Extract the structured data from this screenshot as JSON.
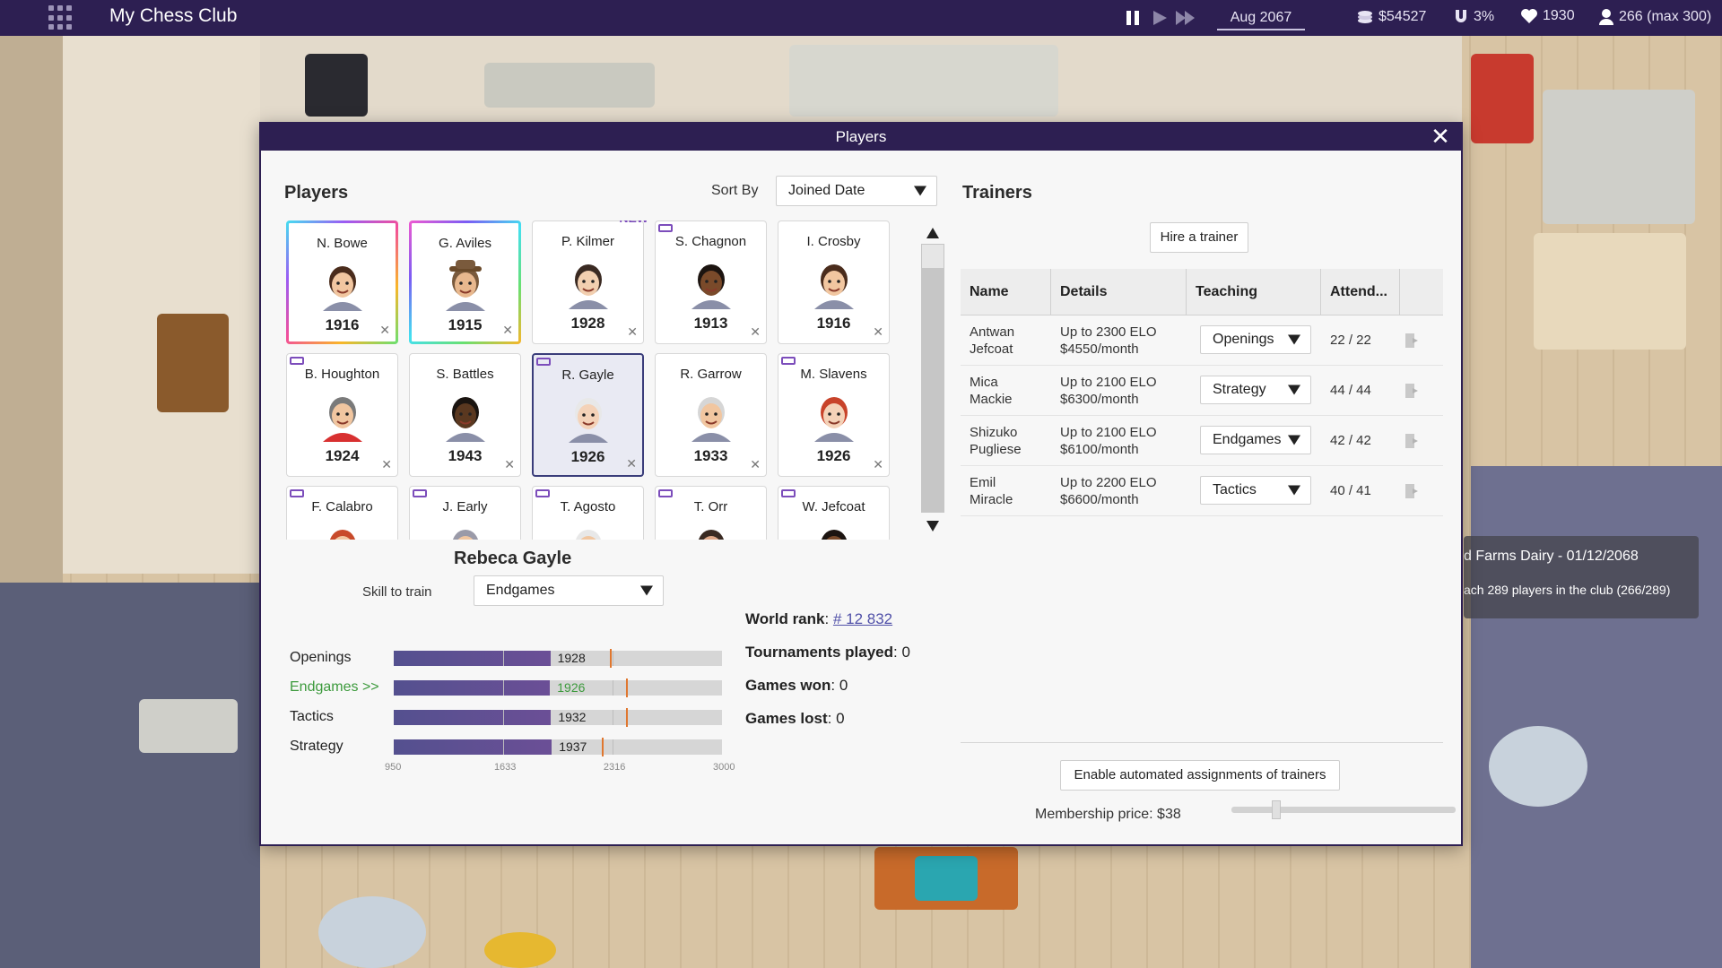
{
  "topbar": {
    "club_name": "My Chess Club",
    "date": "Aug 2067",
    "money": "$54527",
    "percentage": "3%",
    "hearts": "1930",
    "members": "266 (max 300)"
  },
  "dialog": {
    "title": "Players"
  },
  "players_panel": {
    "heading": "Players",
    "sort_label": "Sort By",
    "sort_value": "Joined Date",
    "cards": [
      {
        "name": "N. Bowe",
        "elo": "1916",
        "hair": "#4a2c1c",
        "skin": "#f1c6a0",
        "frame": "rainbow"
      },
      {
        "name": "G. Aviles",
        "elo": "1915",
        "hair": "#7a5a3c",
        "skin": "#e8b88e",
        "frame": "rainbow2",
        "hat": true
      },
      {
        "name": "P. Kilmer",
        "elo": "1928",
        "hair": "#3a2a22",
        "skin": "#f2cfb0",
        "new": "NEW"
      },
      {
        "name": "S. Chagnon",
        "elo": "1913",
        "hair": "#1c1410",
        "skin": "#7a4a2a",
        "tag": true
      },
      {
        "name": "I. Crosby",
        "elo": "1916",
        "hair": "#4a2c1c",
        "skin": "#f1c6a0"
      },
      {
        "name": "B. Houghton",
        "elo": "1924",
        "hair": "#7a7a7a",
        "skin": "#f1c6a0",
        "tag": true,
        "shirt": "#d83030"
      },
      {
        "name": "S. Battles",
        "elo": "1943",
        "hair": "#1a1410",
        "skin": "#5a3820"
      },
      {
        "name": "R. Gayle",
        "elo": "1926",
        "hair": "#e8e8e8",
        "skin": "#f4d2b8",
        "tag": true,
        "selected": true
      },
      {
        "name": "R. Garrow",
        "elo": "1933",
        "hair": "#d6d6d6",
        "skin": "#f1c6a0"
      },
      {
        "name": "M. Slavens",
        "elo": "1926",
        "hair": "#c8432a",
        "skin": "#f4d2b8",
        "tag": true
      },
      {
        "name": "F. Calabro",
        "elo": "",
        "hair": "#c84a2a",
        "skin": "#f1c6a0",
        "tag": true
      },
      {
        "name": "J. Early",
        "elo": "",
        "hair": "#9a9aa8",
        "skin": "#f1c6a0",
        "tag": true
      },
      {
        "name": "T. Agosto",
        "elo": "",
        "hair": "#e8e8e8",
        "skin": "#f1c6a0",
        "tag": true
      },
      {
        "name": "T. Orr",
        "elo": "",
        "hair": "#3a2a22",
        "skin": "#e0a888",
        "tag": true
      },
      {
        "name": "W. Jefcoat",
        "elo": "",
        "hair": "#1c1410",
        "skin": "#7a4a2a",
        "tag": true
      }
    ]
  },
  "selected_player": {
    "name": "Rebeca Gayle",
    "skill_label": "Skill to train",
    "skill_value": "Endgames",
    "skills": [
      {
        "name": "Openings",
        "value": 1928,
        "target": 2300
      },
      {
        "name": "Endgames >>",
        "value": 1926,
        "target": 2400,
        "active": true
      },
      {
        "name": "Tactics",
        "value": 1932,
        "target": 2400
      },
      {
        "name": "Strategy",
        "value": 1937,
        "target": 2250
      }
    ],
    "axis": {
      "min": 950,
      "max": 3000,
      "ticks": [
        "950",
        "1633",
        "2316",
        "3000"
      ]
    },
    "world_rank_label": "World rank",
    "world_rank": "# 12 832",
    "tournaments_label": "Tournaments played",
    "tournaments": "0",
    "games_won_label": "Games won",
    "games_won": "0",
    "games_lost_label": "Games lost",
    "games_lost": "0"
  },
  "trainers_panel": {
    "heading": "Trainers",
    "hire_button": "Hire a trainer",
    "columns": [
      "Name",
      "Details",
      "Teaching",
      "Attend..."
    ],
    "rows": [
      {
        "first": "Antwan",
        "last": "Jefcoat",
        "elo": "Up to 2300 ELO",
        "cost": "$4550/month",
        "teaching": "Openings",
        "attend": "22 / 22"
      },
      {
        "first": "Mica",
        "last": "Mackie",
        "elo": "Up to 2100 ELO",
        "cost": "$6300/month",
        "teaching": "Strategy",
        "attend": "44 / 44"
      },
      {
        "first": "Shizuko",
        "last": "Pugliese",
        "elo": "Up to 2100 ELO",
        "cost": "$6100/month",
        "teaching": "Endgames",
        "attend": "42 / 42"
      },
      {
        "first": "Emil",
        "last": "Miracle",
        "elo": "Up to 2200 ELO",
        "cost": "$6600/month",
        "teaching": "Tactics",
        "attend": "40 / 41"
      }
    ],
    "auto_button": "Enable automated assignments of trainers",
    "membership_label": "Membership price: $38",
    "membership_level": 0.2
  },
  "notification": {
    "title": "d Farms Dairy  -  01/12/2068",
    "body": "ach 289 players in the club (266/289)"
  },
  "colors": {
    "topbar": "#2d1f52",
    "accent": "#7c4dbb",
    "active_skill": "#3c9a3c",
    "target_marker": "#e0772f"
  }
}
